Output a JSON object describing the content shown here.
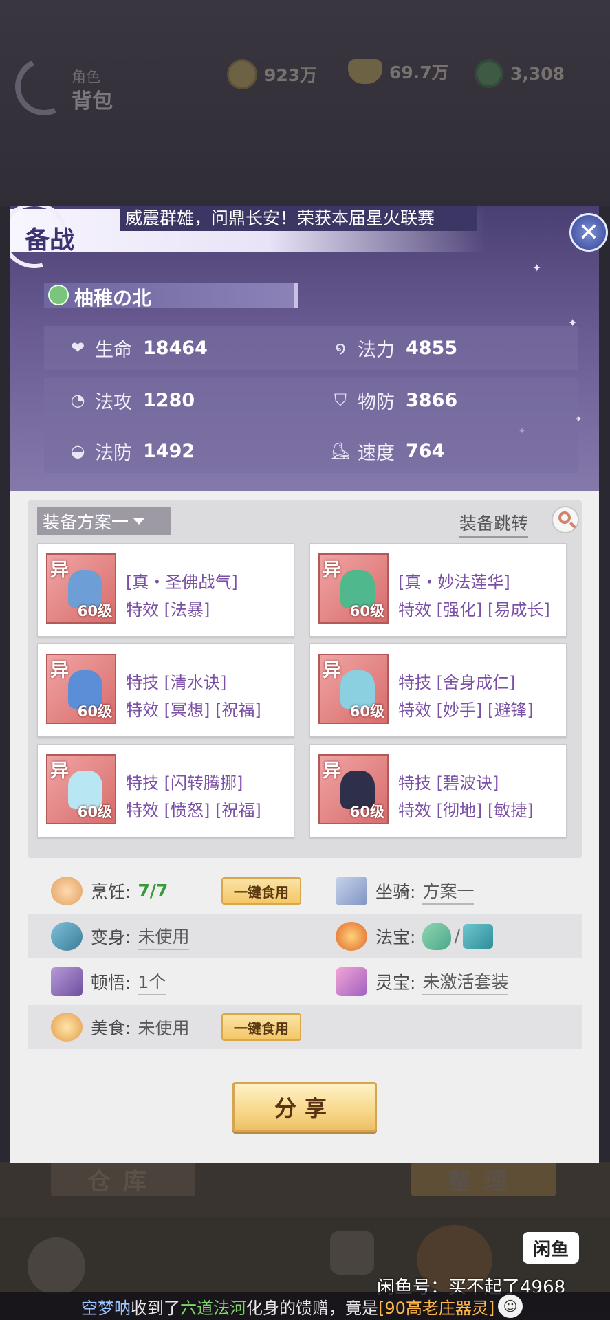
{
  "background": {
    "role_label": "角色",
    "bag_label": "背包",
    "currencies": [
      {
        "icon": "copper-coin-icon",
        "value": "923万"
      },
      {
        "icon": "gold-ingot-icon",
        "value": "69.7万"
      },
      {
        "icon": "jade-icon",
        "value": "3,308"
      }
    ],
    "warehouse_label": "仓库",
    "organize_label": "整理"
  },
  "dialog": {
    "title": "备战",
    "banner_text": "威震群雄，问鼎长安！荣获本届星火联赛",
    "close_glyph": "✕",
    "player_name": "柚稚の北",
    "stats": [
      {
        "icon": "heart-icon",
        "glyph": "❤",
        "label": "生命",
        "value": "18464"
      },
      {
        "icon": "mana-swirl-icon",
        "glyph": "໑",
        "label": "法力",
        "value": "4855"
      },
      {
        "icon": "magic-attack-icon",
        "glyph": "◔",
        "label": "法攻",
        "value": "1280"
      },
      {
        "icon": "physical-defense-icon",
        "glyph": "⛉",
        "label": "物防",
        "value": "3866"
      },
      {
        "icon": "magic-defense-icon",
        "glyph": "◒",
        "label": "法防",
        "value": "1492"
      },
      {
        "icon": "speed-boot-icon",
        "glyph": "⛸",
        "label": "速度",
        "value": "764"
      }
    ],
    "equipment": {
      "scheme_label": "装备方案一",
      "jump_label": "装备跳转",
      "items": [
        {
          "badge": "异",
          "level": "60级",
          "line1": "[真・圣佛战气]",
          "line2": "特效 [法暴]",
          "icon": "staff-weapon-icon",
          "art_color": "#6d9fd6"
        },
        {
          "badge": "异",
          "level": "60级",
          "line1": "[真・妙法莲华]",
          "line2": "特效 [强化] [易成长]",
          "icon": "lotus-headgear-icon",
          "art_color": "#4fb88c"
        },
        {
          "badge": "异",
          "level": "60级",
          "line1": "特技 [清水诀]",
          "line2": "特效 [冥想] [祝福]",
          "icon": "necklace-icon",
          "art_color": "#5a8fd8"
        },
        {
          "badge": "异",
          "level": "60级",
          "line1": "特技 [舍身成仁]",
          "line2": "特效 [妙手] [避锋]",
          "icon": "robe-armor-icon",
          "art_color": "#8ad0e0"
        },
        {
          "badge": "异",
          "level": "60级",
          "line1": "特技 [闪转腾挪]",
          "line2": "特效 [愤怒] [祝福]",
          "icon": "bracelet-icon",
          "art_color": "#b8e6f2"
        },
        {
          "badge": "异",
          "level": "60级",
          "line1": "特技 [碧波诀]",
          "line2": "特效 [彻地] [敏捷]",
          "icon": "boots-icon",
          "art_color": "#2e2f4a"
        }
      ]
    },
    "info": {
      "cooking": {
        "label": "烹饪:",
        "value": "7/7",
        "button": "一键食用"
      },
      "mount": {
        "label": "坐骑:",
        "value": "方案一"
      },
      "transform": {
        "label": "变身:",
        "value": "未使用"
      },
      "treasure": {
        "label": "法宝:",
        "slash": "/"
      },
      "insight": {
        "label": "顿悟:",
        "value": "1个"
      },
      "spirit_treasure": {
        "label": "灵宝:",
        "value": "未激活套装"
      },
      "food": {
        "label": "美食:",
        "value": "未使用",
        "button": "一键食用"
      }
    },
    "share_label": "分享"
  },
  "ticker": {
    "player": "空梦呐",
    "text1": "收到了",
    "item": "六道法河",
    "text2": "化身的馈赠，竟是",
    "reward": "[90高老庄器灵]"
  },
  "watermark": {
    "logo": "闲鱼",
    "text": "闲鱼号：买不起了4968"
  },
  "colors": {
    "header_purple": "#6a5c93",
    "effect_text": "#7a4fa6",
    "item_bg_red": "#d86c6c",
    "button_gold": "#f3c766"
  }
}
